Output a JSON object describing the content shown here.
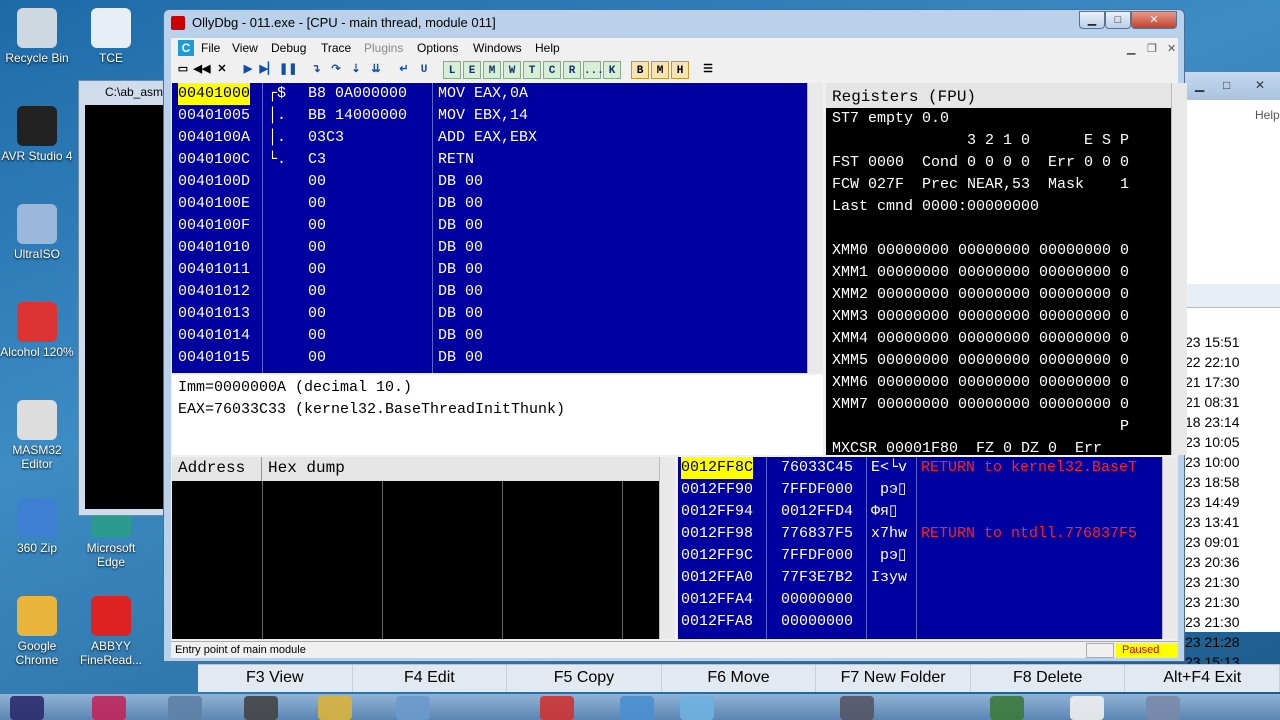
{
  "desktop": {
    "icons": [
      {
        "label": "Recycle Bin"
      },
      {
        "label": "TCE"
      },
      {
        "label": "AVR Studio 4"
      },
      {
        "label": "UltraISO"
      },
      {
        "label": "Alcohol 120%"
      },
      {
        "label": "MASM32 Editor"
      },
      {
        "label": "360 Zip"
      },
      {
        "label": "Microsoft Edge"
      },
      {
        "label": "Google Chrome"
      },
      {
        "label": "ABBYY FineRead..."
      }
    ],
    "bg_window_title": "C:\\ab_asm",
    "right_window": {
      "help": "Help",
      "dates": [
        "23 15:51",
        "22 22:10",
        "21 17:30",
        "21 08:31",
        "18 23:14",
        "23 10:05",
        "23 10:00",
        "23 18:58",
        "23 14:49",
        "23 13:41",
        "23 09:01",
        "23 20:36",
        "23 21:30",
        "23 21:30",
        "23 21:30",
        "23 21:28",
        "23 15:13"
      ]
    }
  },
  "window": {
    "title": "OllyDbg - 011.exe - [CPU - main thread, module 011]"
  },
  "menu": [
    "File",
    "View",
    "Debug",
    "Trace",
    "Plugins",
    "Options",
    "Windows",
    "Help"
  ],
  "toolbar": {
    "letters": [
      "L",
      "E",
      "M",
      "W",
      "T",
      "C",
      "R",
      "...",
      "K"
    ],
    "extra": [
      "B",
      "M",
      "H"
    ]
  },
  "cpu": {
    "rows": [
      {
        "addr": "00401000",
        "mark": "┌$",
        "hex": "B8 0A000000",
        "dis": "MOV EAX,0A",
        "selected": true
      },
      {
        "addr": "00401005",
        "mark": "│.",
        "hex": "BB 14000000",
        "dis": "MOV EBX,14"
      },
      {
        "addr": "0040100A",
        "mark": "│.",
        "hex": "03C3",
        "dis": "ADD EAX,EBX"
      },
      {
        "addr": "0040100C",
        "mark": "└.",
        "hex": "C3",
        "dis": "RETN"
      },
      {
        "addr": "0040100D",
        "mark": "",
        "hex": "00",
        "dis": "DB 00"
      },
      {
        "addr": "0040100E",
        "mark": "",
        "hex": "00",
        "dis": "DB 00"
      },
      {
        "addr": "0040100F",
        "mark": "",
        "hex": "00",
        "dis": "DB 00"
      },
      {
        "addr": "00401010",
        "mark": "",
        "hex": "00",
        "dis": "DB 00"
      },
      {
        "addr": "00401011",
        "mark": "",
        "hex": "00",
        "dis": "DB 00"
      },
      {
        "addr": "00401012",
        "mark": "",
        "hex": "00",
        "dis": "DB 00"
      },
      {
        "addr": "00401013",
        "mark": "",
        "hex": "00",
        "dis": "DB 00"
      },
      {
        "addr": "00401014",
        "mark": "",
        "hex": "00",
        "dis": "DB 00"
      },
      {
        "addr": "00401015",
        "mark": "",
        "hex": "00",
        "dis": "DB 00"
      }
    ]
  },
  "info": {
    "line1": "Imm=0000000A (decimal 10.)",
    "line2": "EAX=76033C33 (kernel32.BaseThreadInitThunk)"
  },
  "registers": {
    "header": "Registers (FPU)",
    "lines": [
      "ST7 empty 0.0",
      "               3 2 1 0      E S P",
      "FST 0000  Cond 0 0 0 0  Err 0 0 0",
      "FCW 027F  Prec NEAR,53  Mask    1",
      "Last cmnd 0000:00000000",
      "",
      "XMM0 00000000 00000000 00000000 0",
      "XMM1 00000000 00000000 00000000 0",
      "XMM2 00000000 00000000 00000000 0",
      "XMM3 00000000 00000000 00000000 0",
      "XMM4 00000000 00000000 00000000 0",
      "XMM5 00000000 00000000 00000000 0",
      "XMM6 00000000 00000000 00000000 0",
      "XMM7 00000000 00000000 00000000 0",
      "                                P",
      "MXCSR 00001F80  FZ 0 DZ 0  Err"
    ]
  },
  "dump": {
    "headers": [
      "Address",
      "Hex dump"
    ]
  },
  "stack": {
    "rows": [
      {
        "addr": "0012FF8C",
        "val": "76033C45",
        "str": "E<└v",
        "comment": "RETURN to kernel32.BaseT",
        "selected": true
      },
      {
        "addr": "0012FF90",
        "val": "7FFDF000",
        "str": " рэ▯",
        "comment": ""
      },
      {
        "addr": "0012FF94",
        "val": "0012FFD4",
        "str": "Фя▯",
        "comment": ""
      },
      {
        "addr": "0012FF98",
        "val": "776837F5",
        "str": "x7hw",
        "comment": "RETURN to ntdll.776837F5"
      },
      {
        "addr": "0012FF9C",
        "val": "7FFDF000",
        "str": " рэ▯",
        "comment": ""
      },
      {
        "addr": "0012FFA0",
        "val": "77F3E7B2",
        "str": "Iзyw",
        "comment": ""
      },
      {
        "addr": "0012FFA4",
        "val": "00000000",
        "str": "",
        "comment": ""
      },
      {
        "addr": "0012FFA8",
        "val": "00000000",
        "str": "",
        "comment": ""
      }
    ]
  },
  "status": {
    "text": "Entry point of main module",
    "state": "Paused"
  },
  "fkeys": [
    "F3 View",
    "F4 Edit",
    "F5 Copy",
    "F6 Move",
    "F7 New Folder",
    "F8 Delete",
    "Alt+F4 Exit"
  ]
}
